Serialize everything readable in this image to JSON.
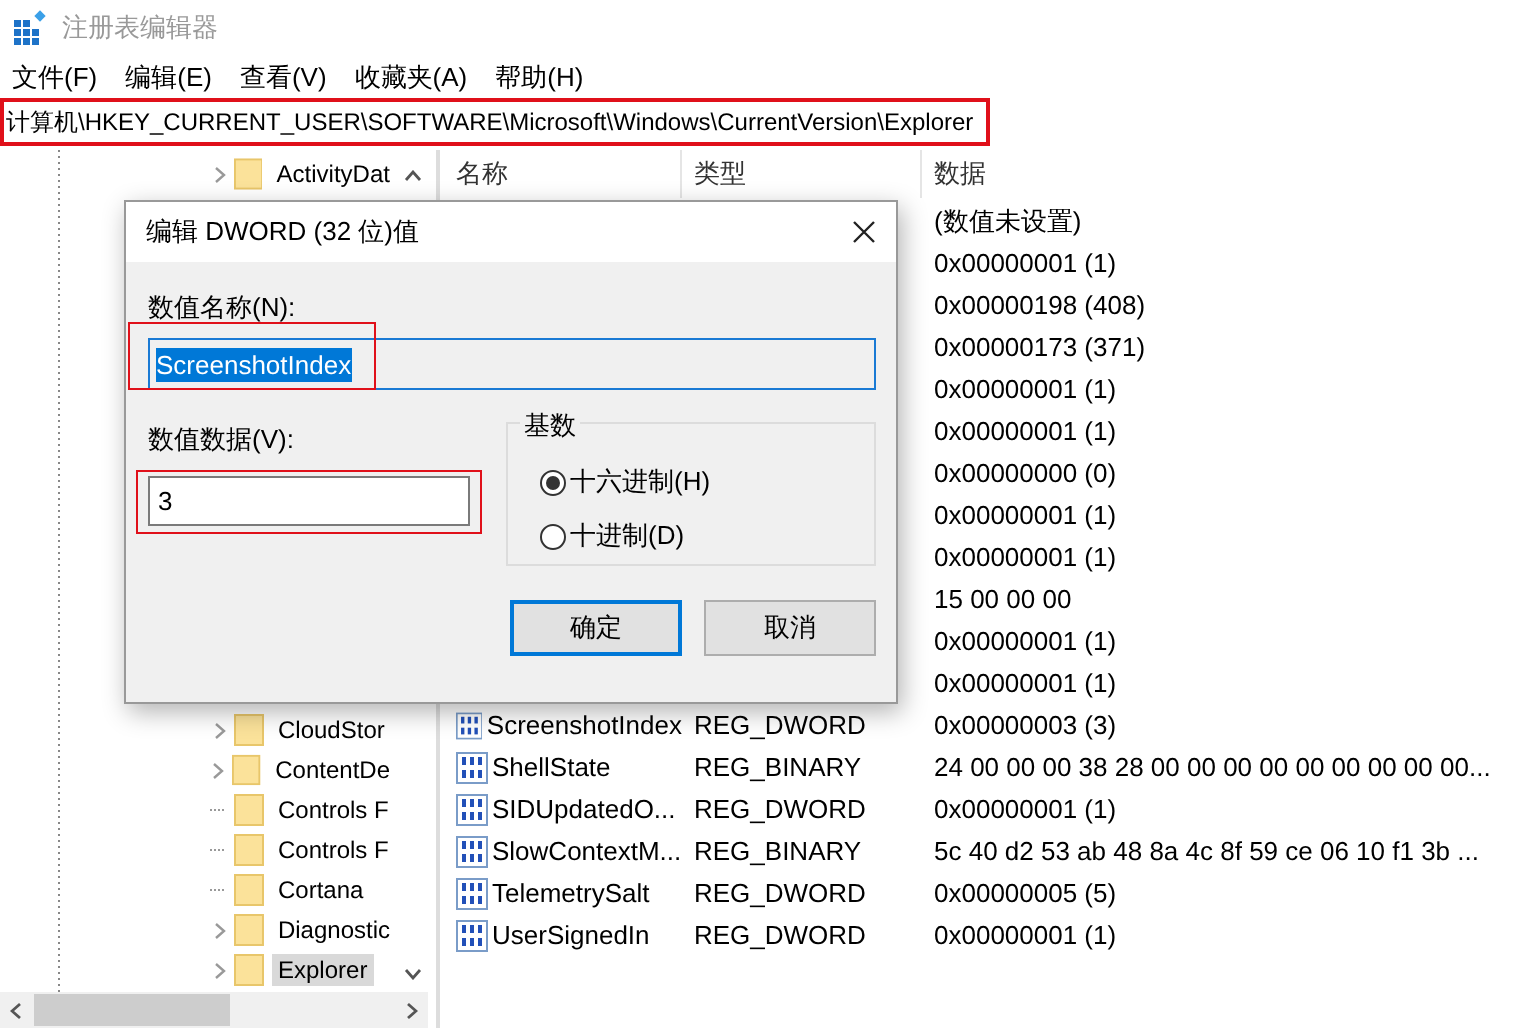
{
  "window": {
    "title": "注册表编辑器"
  },
  "menu": [
    "文件(F)",
    "编辑(E)",
    "查看(V)",
    "收藏夹(A)",
    "帮助(H)"
  ],
  "address": {
    "path": "计算机\\HKEY_CURRENT_USER\\SOFTWARE\\Microsoft\\Windows\\CurrentVersion\\Explorer",
    "highlighted": true
  },
  "tree": [
    {
      "label": "ActivityDat",
      "expandable": true,
      "selected": false
    },
    {
      "label": "CloudStor",
      "expandable": true,
      "selected": false,
      "gap_before": true
    },
    {
      "label": "ContentDe",
      "expandable": true,
      "selected": false
    },
    {
      "label": "Controls F",
      "expandable": false,
      "selected": false
    },
    {
      "label": "Controls F",
      "expandable": false,
      "selected": false
    },
    {
      "label": "Cortana",
      "expandable": false,
      "selected": false
    },
    {
      "label": "Diagnostic",
      "expandable": true,
      "selected": false
    },
    {
      "label": "Explorer",
      "expandable": true,
      "selected": true
    }
  ],
  "list": {
    "columns": [
      "名称",
      "类型",
      "数据"
    ],
    "rows": [
      {
        "data": "(数值未设置)"
      },
      {
        "data": "0x00000001 (1)"
      },
      {
        "data": "0x00000198 (408)"
      },
      {
        "data": "0x00000173 (371)"
      },
      {
        "data": "0x00000001 (1)"
      },
      {
        "data": "0x00000001 (1)"
      },
      {
        "data": "0x00000000 (0)"
      },
      {
        "data": "0x00000001 (1)"
      },
      {
        "data": "0x00000001 (1)"
      },
      {
        "data": "15 00 00 00"
      },
      {
        "data": "0x00000001 (1)"
      },
      {
        "data": "0x00000001 (1)"
      },
      {
        "name": "ScreenshotIndex",
        "type": "REG_DWORD",
        "data": "0x00000003 (3)"
      },
      {
        "name": "ShellState",
        "type": "REG_BINARY",
        "data": "24 00 00 00 38 28 00 00 00 00 00 00 00 00 00..."
      },
      {
        "name": "SIDUpdatedO...",
        "type": "REG_DWORD",
        "data": "0x00000001 (1)"
      },
      {
        "name": "SlowContextM...",
        "type": "REG_BINARY",
        "data": "5c 40 d2 53 ab 48 8a 4c 8f 59 ce 06 10 f1 3b ..."
      },
      {
        "name": "TelemetrySalt",
        "type": "REG_DWORD",
        "data": "0x00000005 (5)"
      },
      {
        "name": "UserSignedIn",
        "type": "REG_DWORD",
        "data": "0x00000001 (1)"
      }
    ]
  },
  "dialog": {
    "title": "编辑 DWORD (32 位)值",
    "name_label": "数值名称(N):",
    "name_value": {
      "text": "ScreenshotIndex",
      "highlighted": true
    },
    "data_label": "数值数据(V):",
    "data_value": {
      "text": "3",
      "highlighted": true
    },
    "base": {
      "title": "基数",
      "options": [
        {
          "label": "十六进制(H)",
          "selected": true
        },
        {
          "label": "十进制(D)",
          "selected": false
        }
      ]
    },
    "buttons": [
      {
        "label": "确定",
        "default": true
      },
      {
        "label": "取消",
        "default": false
      }
    ]
  }
}
